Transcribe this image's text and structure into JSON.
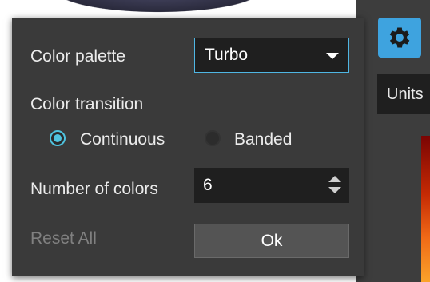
{
  "dialog": {
    "palette_label": "Color palette",
    "palette_value": "Turbo",
    "transition_label": "Color transition",
    "transition_options": [
      {
        "label": "Continuous",
        "selected": true
      },
      {
        "label": "Banded",
        "selected": false
      }
    ],
    "num_colors_label": "Number of colors",
    "num_colors_value": "6",
    "reset_label": "Reset All",
    "ok_label": "Ok"
  },
  "side_panel": {
    "units_label": "Units"
  },
  "colors": {
    "accent": "#4fb6e3",
    "gear_button": "#3ea3df",
    "dialog_bg": "#3a3a3a",
    "field_bg": "#1f1f1f"
  },
  "icons": {
    "settings": "gear-icon",
    "dropdown": "chevron-down-icon",
    "stepper": "spin-arrows-icon"
  }
}
